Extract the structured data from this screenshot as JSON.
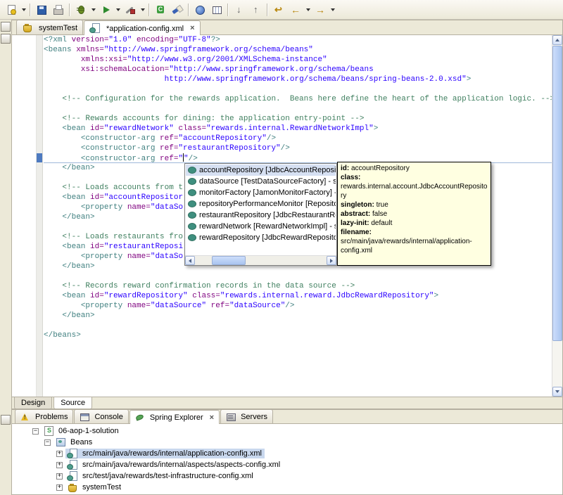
{
  "window": {
    "bg": "#ECE9D8",
    "accent": "#316AC5"
  },
  "syntax_colors": {
    "tag": "#3F7F7F",
    "attr": "#7F007F",
    "val": "#2A00FF",
    "comment": "#3F7F5F",
    "plain": "#000000"
  },
  "toolbar": {
    "items": [
      {
        "type": "icon",
        "name": "new-wizard",
        "glyph": "new"
      },
      {
        "type": "dropdown",
        "name": "new-wizard-dropdown"
      },
      {
        "type": "sep"
      },
      {
        "type": "icon",
        "name": "save",
        "glyph": "save"
      },
      {
        "type": "icon",
        "name": "print",
        "glyph": "print"
      },
      {
        "type": "sep"
      },
      {
        "type": "icon",
        "name": "debug",
        "glyph": "debug"
      },
      {
        "type": "dropdown",
        "name": "debug-dropdown"
      },
      {
        "type": "icon",
        "name": "run",
        "glyph": "run"
      },
      {
        "type": "dropdown",
        "name": "run-dropdown"
      },
      {
        "type": "icon",
        "name": "external-tools",
        "glyph": "tools"
      },
      {
        "type": "dropdown",
        "name": "external-tools-dropdown"
      },
      {
        "type": "sep"
      },
      {
        "type": "icon",
        "name": "new-java-class",
        "glyph": "class"
      },
      {
        "type": "icon",
        "name": "search",
        "glyph": "search"
      },
      {
        "type": "sep"
      },
      {
        "type": "icon",
        "name": "open-web-browser",
        "glyph": "globe"
      },
      {
        "type": "icon",
        "name": "show-table",
        "glyph": "table"
      },
      {
        "type": "sep"
      },
      {
        "type": "icon",
        "name": "next-annotation",
        "glyph": "down"
      },
      {
        "type": "icon",
        "name": "previous-annotation",
        "glyph": "up"
      },
      {
        "type": "sep"
      },
      {
        "type": "icon",
        "name": "last-edit-location",
        "glyph": "lastedit"
      },
      {
        "type": "icon",
        "name": "back",
        "glyph": "back"
      },
      {
        "type": "dropdown",
        "name": "back-dropdown"
      },
      {
        "type": "icon",
        "name": "forward",
        "glyph": "forward"
      },
      {
        "type": "dropdown",
        "name": "forward-dropdown"
      }
    ]
  },
  "editor": {
    "close_label": "×",
    "tabs": [
      {
        "label": "systemTest",
        "icon": "config-set",
        "active": false,
        "closable": false
      },
      {
        "label": "*application-config.xml",
        "icon": "config-file",
        "active": true,
        "closable": true
      }
    ],
    "page_tabs": [
      {
        "label": "Design",
        "active": false
      },
      {
        "label": "Source",
        "active": true
      }
    ],
    "cursor_line_index": 12,
    "lines": [
      [
        [
          "<?xml ",
          "tag"
        ],
        [
          "version=",
          "attr"
        ],
        [
          "\"1.0\"",
          "val"
        ],
        [
          " ",
          "plain"
        ],
        [
          "encoding=",
          "attr"
        ],
        [
          "\"UTF-8\"",
          "val"
        ],
        [
          "?>",
          "tag"
        ]
      ],
      [
        [
          "<beans ",
          "tag"
        ],
        [
          "xmlns=",
          "attr"
        ],
        [
          "\"http://www.springframework.org/schema/beans\"",
          "val"
        ]
      ],
      [
        [
          "        ",
          "plain"
        ],
        [
          "xmlns:xsi=",
          "attr"
        ],
        [
          "\"http://www.w3.org/2001/XMLSchema-instance\"",
          "val"
        ]
      ],
      [
        [
          "        ",
          "plain"
        ],
        [
          "xsi:schemaLocation=",
          "attr"
        ],
        [
          "\"http://www.springframework.org/schema/beans",
          "val"
        ]
      ],
      [
        [
          "                          ",
          "plain"
        ],
        [
          "http://www.springframework.org/schema/beans/spring-beans-2.0.xsd\"",
          "val"
        ],
        [
          ">",
          "tag"
        ]
      ],
      [],
      [
        [
          "    ",
          "plain"
        ],
        [
          "<!-- Configuration for the rewards application.  Beans here define the heart of the application logic. -->",
          "comment"
        ]
      ],
      [],
      [
        [
          "    ",
          "plain"
        ],
        [
          "<!-- Rewards accounts for dining: the application entry-point -->",
          "comment"
        ]
      ],
      [
        [
          "    ",
          "plain"
        ],
        [
          "<bean ",
          "tag"
        ],
        [
          "id=",
          "attr"
        ],
        [
          "\"rewardNetwork\"",
          "val"
        ],
        [
          " ",
          "plain"
        ],
        [
          "class=",
          "attr"
        ],
        [
          "\"rewards.internal.RewardNetworkImpl\"",
          "val"
        ],
        [
          ">",
          "tag"
        ]
      ],
      [
        [
          "        ",
          "plain"
        ],
        [
          "<constructor-arg ",
          "tag"
        ],
        [
          "ref=",
          "attr"
        ],
        [
          "\"accountRepository\"",
          "val"
        ],
        [
          "/>",
          "tag"
        ]
      ],
      [
        [
          "        ",
          "plain"
        ],
        [
          "<constructor-arg ",
          "tag"
        ],
        [
          "ref=",
          "attr"
        ],
        [
          "\"restaurantRepository\"",
          "val"
        ],
        [
          "/>",
          "tag"
        ]
      ],
      [
        [
          "        ",
          "plain"
        ],
        [
          "<constructor-arg ",
          "tag"
        ],
        [
          "ref=",
          "attr"
        ],
        [
          "\"",
          "val"
        ],
        [
          "",
          "caret"
        ],
        [
          "\"",
          "val"
        ],
        [
          "/>",
          "tag"
        ]
      ],
      [
        [
          "    ",
          "plain"
        ],
        [
          "</bean>",
          "tag"
        ]
      ],
      [],
      [
        [
          "    ",
          "plain"
        ],
        [
          "<!-- Loads accounts from t",
          "comment"
        ]
      ],
      [
        [
          "    ",
          "plain"
        ],
        [
          "<bean ",
          "tag"
        ],
        [
          "id=",
          "attr"
        ],
        [
          "\"accountRepositor",
          "val"
        ]
      ],
      [
        [
          "        ",
          "plain"
        ],
        [
          "<property ",
          "tag"
        ],
        [
          "name=",
          "attr"
        ],
        [
          "\"dataSo",
          "val"
        ]
      ],
      [
        [
          "    ",
          "plain"
        ],
        [
          "</bean>",
          "tag"
        ]
      ],
      [],
      [
        [
          "    ",
          "plain"
        ],
        [
          "<!-- Loads restaurants fro",
          "comment"
        ]
      ],
      [
        [
          "    ",
          "plain"
        ],
        [
          "<bean ",
          "tag"
        ],
        [
          "id=",
          "attr"
        ],
        [
          "\"restaurantReposi",
          "val"
        ]
      ],
      [
        [
          "        ",
          "plain"
        ],
        [
          "<property ",
          "tag"
        ],
        [
          "name=",
          "attr"
        ],
        [
          "\"dataSo",
          "val"
        ]
      ],
      [
        [
          "    ",
          "plain"
        ],
        [
          "</bean>",
          "tag"
        ]
      ],
      [],
      [
        [
          "    ",
          "plain"
        ],
        [
          "<!-- Records reward confirmation records in the data source -->",
          "comment"
        ]
      ],
      [
        [
          "    ",
          "plain"
        ],
        [
          "<bean ",
          "tag"
        ],
        [
          "id=",
          "attr"
        ],
        [
          "\"rewardRepository\"",
          "val"
        ],
        [
          " ",
          "plain"
        ],
        [
          "class=",
          "attr"
        ],
        [
          "\"rewards.internal.reward.JdbcRewardRepository\"",
          "val"
        ],
        [
          ">",
          "tag"
        ]
      ],
      [
        [
          "        ",
          "plain"
        ],
        [
          "<property ",
          "tag"
        ],
        [
          "name=",
          "attr"
        ],
        [
          "\"dataSource\"",
          "val"
        ],
        [
          " ",
          "plain"
        ],
        [
          "ref=",
          "attr"
        ],
        [
          "\"dataSource\"",
          "val"
        ],
        [
          "/>",
          "tag"
        ]
      ],
      [
        [
          "    ",
          "plain"
        ],
        [
          "</bean>",
          "tag"
        ]
      ],
      [],
      [
        [
          "</beans>",
          "tag"
        ]
      ]
    ]
  },
  "assist_popup": {
    "selected_index": 0,
    "items": [
      "accountRepository [JdbcAccountRepository] - src/main/ja",
      "dataSource [TestDataSourceFactory] - src/test/ja",
      "monitorFactory [JamonMonitorFactory] - src/main",
      "repositoryPerformanceMonitor [RepositoryPerfor",
      "restaurantRepository [JdbcRestaurantRepository",
      "rewardNetwork [RewardNetworkImpl] - src/main/j",
      "rewardRepository [JdbcRewardRepository] - src/"
    ]
  },
  "bean_tooltip": {
    "bg": "#FFFFE1",
    "fields": [
      {
        "label": "id:",
        "value": "accountRepository"
      },
      {
        "label": "class:",
        "value": "rewards.internal.account.JdbcAccountRepository"
      },
      {
        "label": "singleton:",
        "value": "true"
      },
      {
        "label": "abstract:",
        "value": "false"
      },
      {
        "label": "lazy-init:",
        "value": "default"
      },
      {
        "label": "filename:",
        "value": "src/main/java/rewards/internal/application-config.xml"
      }
    ]
  },
  "views": {
    "close_label": "×",
    "tabs": [
      {
        "label": "Problems",
        "icon": "problems",
        "active": false,
        "closable": false
      },
      {
        "label": "Console",
        "icon": "console",
        "active": false,
        "closable": false
      },
      {
        "label": "Spring Explorer",
        "icon": "spring",
        "active": true,
        "closable": true
      },
      {
        "label": "Servers",
        "icon": "servers",
        "active": false,
        "closable": false
      }
    ],
    "tree": [
      {
        "label": "06-aop-1-solution",
        "level": 0,
        "expander": "-",
        "icon": "spring-project",
        "selected": false
      },
      {
        "label": "Beans",
        "level": 1,
        "expander": "-",
        "icon": "beans",
        "selected": false
      },
      {
        "label": "src/main/java/rewards/internal/application-config.xml",
        "level": 2,
        "expander": "+",
        "icon": "config-file",
        "selected": true
      },
      {
        "label": "src/main/java/rewards/internal/aspects/aspects-config.xml",
        "level": 2,
        "expander": "+",
        "icon": "config-file",
        "selected": false
      },
      {
        "label": "src/test/java/rewards/test-infrastructure-config.xml",
        "level": 2,
        "expander": "+",
        "icon": "config-file",
        "selected": false
      },
      {
        "label": "systemTest",
        "level": 2,
        "expander": "+",
        "icon": "config-set",
        "selected": false
      }
    ]
  }
}
